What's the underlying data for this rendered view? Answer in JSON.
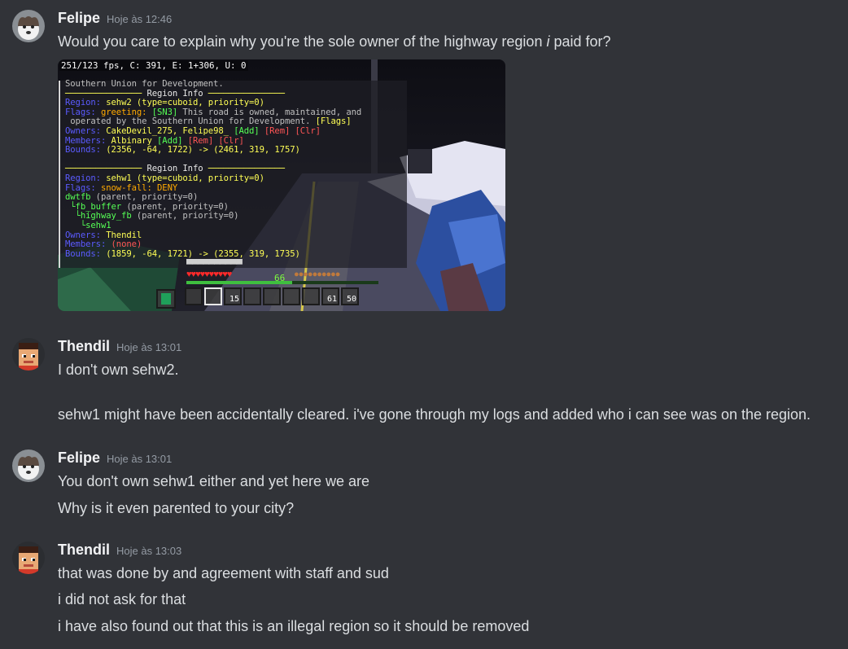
{
  "timestamp_prefix": "Hoje às",
  "messages": [
    {
      "author": "Felipe",
      "time": "Hoje às 12:46",
      "lines_plain": [
        "Would you care to explain why you're the sole owner of the highway region ",
        "i",
        " paid for?"
      ]
    },
    {
      "author": "Thendil",
      "time": "Hoje às 13:01",
      "lines": [
        "I don't own sehw2.",
        "sehw1 might have been accidentally cleared. i've gone through my logs and added who i can see was on the region."
      ]
    },
    {
      "author": "Felipe",
      "time": "Hoje às 13:01",
      "lines": [
        "You don't own sehw1 either and yet here we are",
        "Why is it even parented to your city?"
      ]
    },
    {
      "author": "Thendil",
      "time": "Hoje às 13:03",
      "lines": [
        "that was done by and agreement with staff and sud",
        "i did not ask for that",
        "i have also found out that this is an illegal region so it should be removed"
      ]
    }
  ],
  "screenshot": {
    "fps_text": "251/123 fps, C: 391, E: 1+306, U: 0",
    "region1": {
      "title_line": "Southern Union for Development.",
      "header": "Region Info",
      "region_label": "Region:",
      "region_value": "sehw2 (type=cuboid, priority=0)",
      "flags_label": "Flags:",
      "flags_value_a": "greeting:",
      "flags_tag": "[SN3]",
      "flags_value_b": " This road is owned, maintained, and",
      "flags_value_c": " operated by the Southern Union for Development.",
      "flags_link": "[Flags]",
      "owners_label": "Owners:",
      "owners_value": "CakeDevil_275, Felipe98_",
      "add": "[Add]",
      "rem": "[Rem]",
      "clr": "[Clr]",
      "members_label": "Members:",
      "members_value": "Albinary",
      "bounds_label": "Bounds:",
      "bounds_value": "(2356, -64, 1722) -> (2461, 319, 1757)"
    },
    "region2": {
      "header": "Region Info",
      "region_label": "Region:",
      "region_value": "sehw1 (type=cuboid, priority=0)",
      "flags_label": "Flags:",
      "flags_value": "snow-fall: DENY",
      "parent1": "dwtfb",
      "parent1_meta": " (parent, priority=0)",
      "parent2": " └fb_buffer",
      "parent2_meta": " (parent, priority=0)",
      "parent3": "  └highway_fb",
      "parent3_meta": " (parent, priority=0)",
      "parent4": "   └sehw1",
      "owners_label": "Owners:",
      "owners_value": "Thendil",
      "members_label": "Members:",
      "members_value": "(none)",
      "bounds_label": "Bounds:",
      "bounds_value": "(1859, -64, 1721) -> (2355, 319, 1735)"
    },
    "hud": {
      "level": "66",
      "slot_counts": [
        "",
        "",
        "15",
        "",
        "",
        "",
        "",
        "61",
        "50"
      ],
      "xp_fraction": 0.55
    }
  }
}
